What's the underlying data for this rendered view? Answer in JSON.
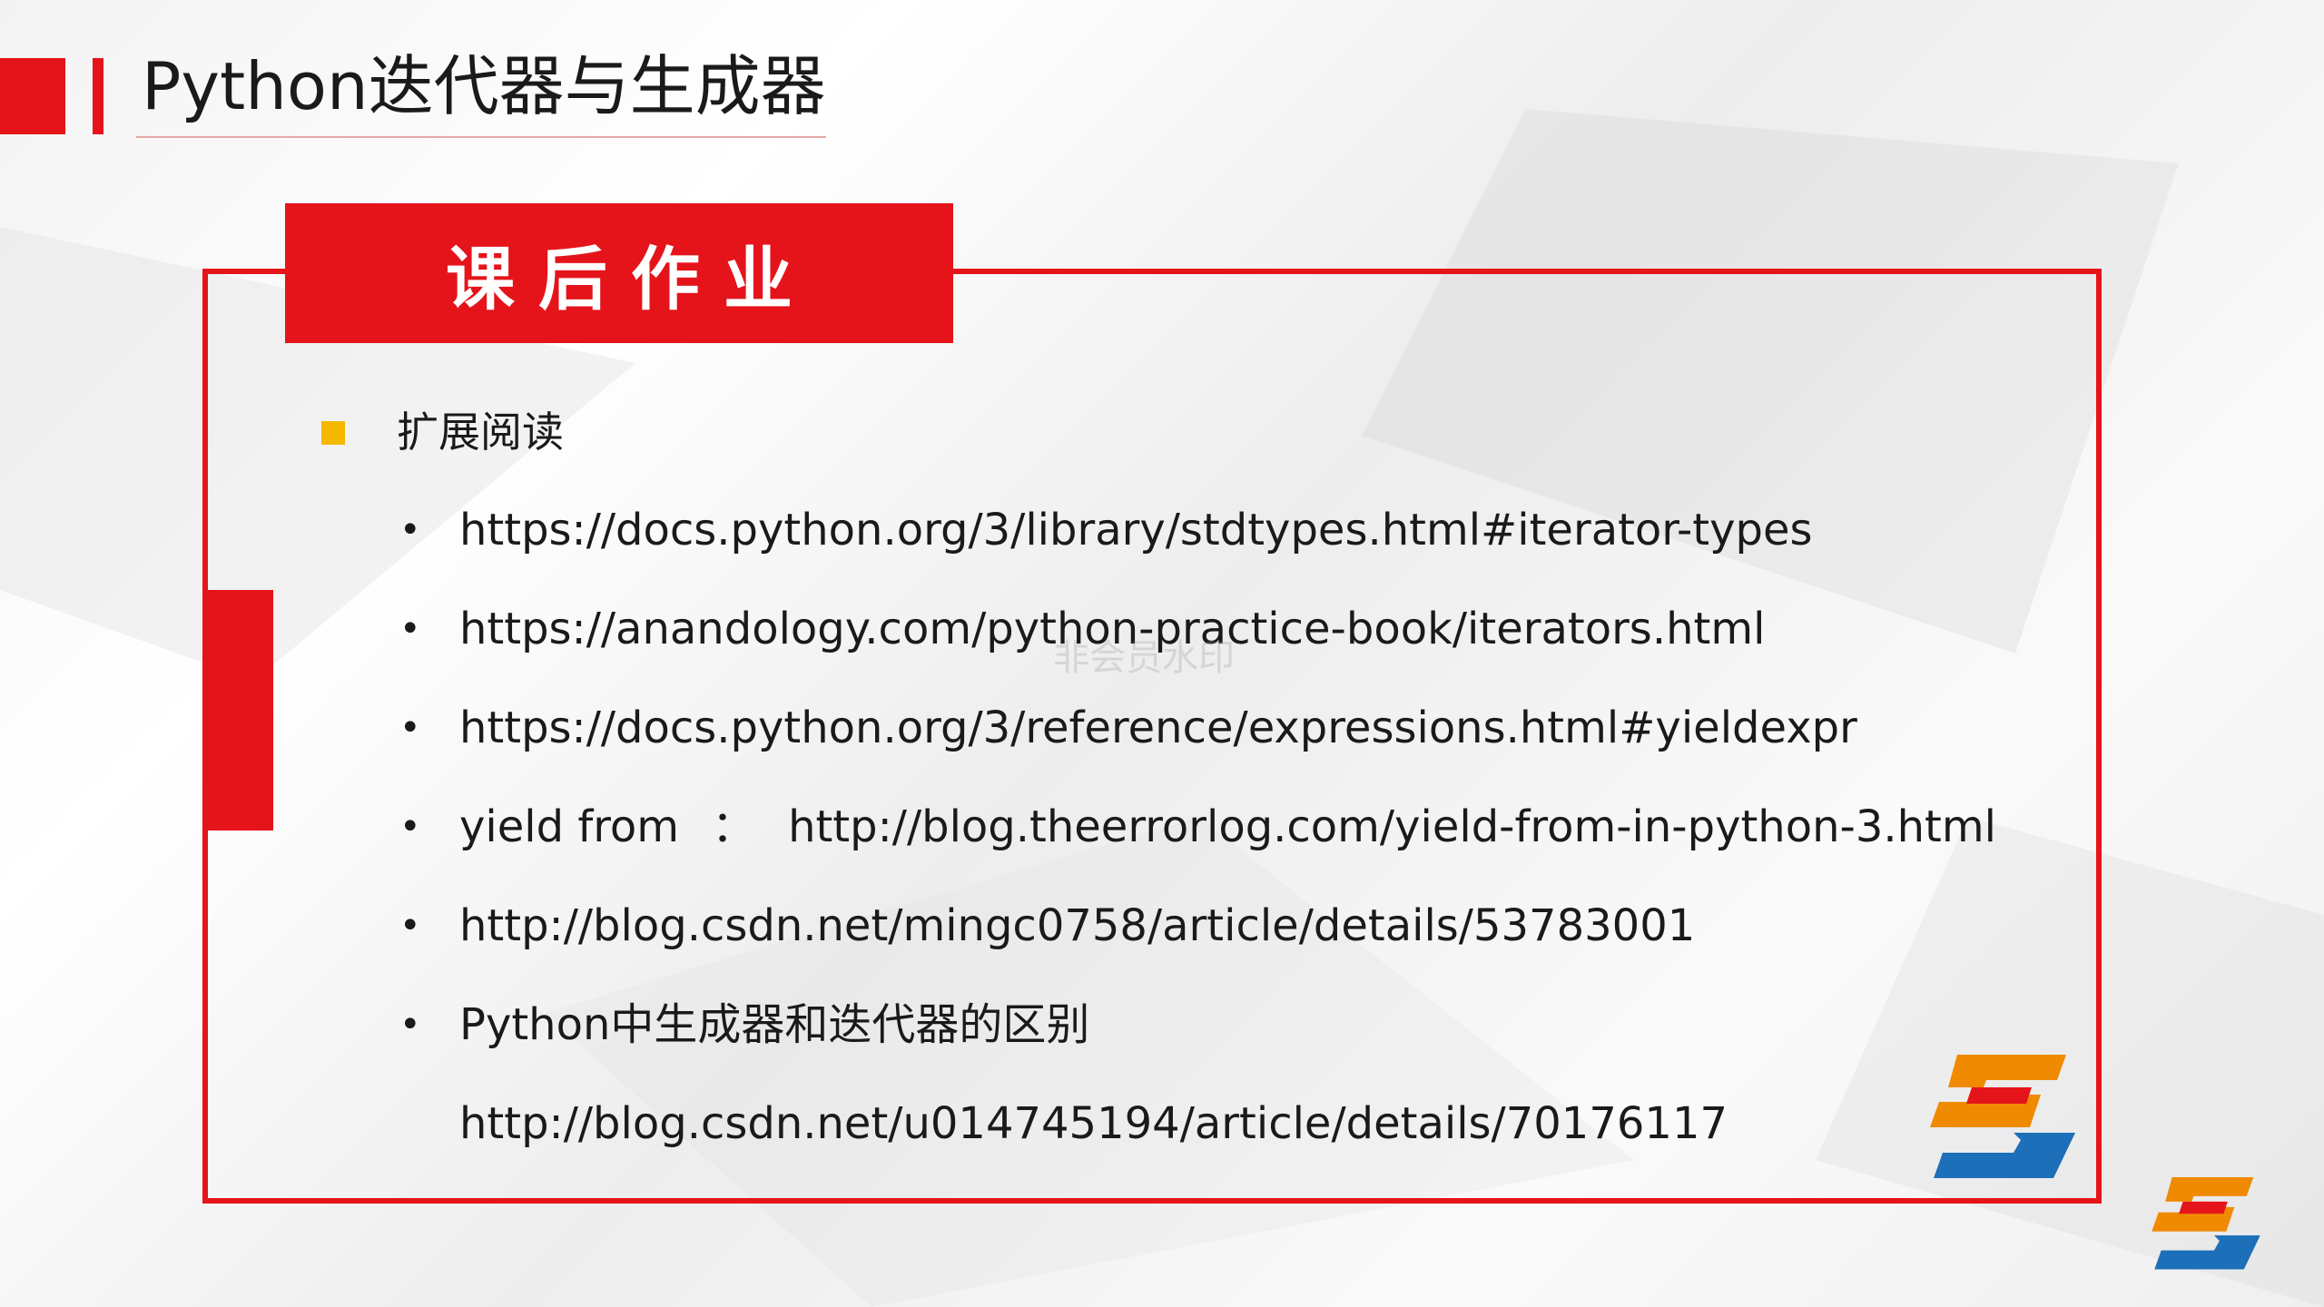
{
  "header": {
    "title": "Python迭代器与生成器"
  },
  "section": {
    "banner": "课后作业",
    "subheading": "扩展阅读"
  },
  "links": [
    {
      "text": "https://docs.python.org/3/library/stdtypes.html#iterator-types"
    },
    {
      "text": "https://anandology.com/python-practice-book/iterators.html"
    },
    {
      "text": "https://docs.python.org/3/reference/expressions.html#yieldexpr"
    },
    {
      "label": "yield from",
      "separator": "：",
      "text": "http://blog.theerrorlog.com/yield-from-in-python-3.html"
    },
    {
      "text": "http://blog.csdn.net/mingc0758/article/details/53783001"
    },
    {
      "text": "Python中生成器和迭代器的区别"
    }
  ],
  "continuation": "http://blog.csdn.net/u014745194/article/details/70176117",
  "bullet_glyph": "•",
  "watermark": "非会员水印",
  "colors": {
    "accent_red": "#e5141b",
    "bullet_yellow": "#f5b800",
    "logo_orange": "#f08a00",
    "logo_red": "#e5141b",
    "logo_blue": "#1c6fb8"
  },
  "icons": {
    "logo": "sj-logo-icon"
  }
}
